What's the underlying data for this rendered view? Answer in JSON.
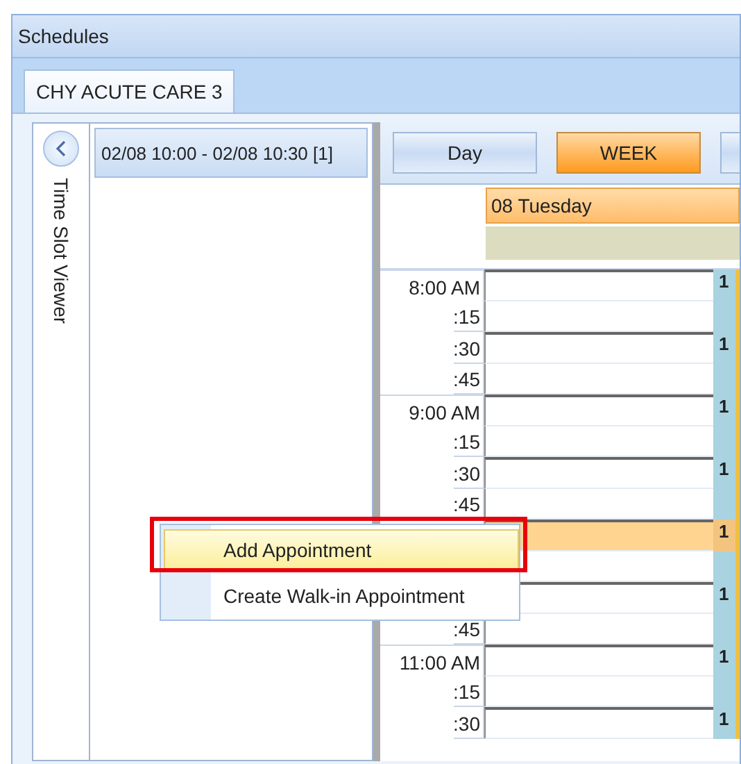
{
  "window": {
    "title": "Schedules"
  },
  "tabs": [
    {
      "label": "CHY ACUTE CARE 3",
      "selected": true
    }
  ],
  "side_panel": {
    "title": "Time Slot Viewer",
    "items": [
      {
        "label": "02/08 10:00 - 02/08 10:30 [1]",
        "selected": true
      }
    ]
  },
  "view_buttons": [
    {
      "label": "Day",
      "selected": false
    },
    {
      "label": "WEEK",
      "selected": true
    },
    {
      "selected": false
    }
  ],
  "day_header": {
    "label": "08 Tuesday"
  },
  "slots": [
    {
      "label": "8:00 AM",
      "hour": true,
      "count": "1",
      "selected": false
    },
    {
      "label": ":15",
      "hour": false,
      "selected": false
    },
    {
      "label": ":30",
      "hour": false,
      "count": "1",
      "selected": false
    },
    {
      "label": ":45",
      "hour": false,
      "selected": false
    },
    {
      "label": "9:00 AM",
      "hour": true,
      "count": "1",
      "selected": false
    },
    {
      "label": ":15",
      "hour": false,
      "selected": false
    },
    {
      "label": ":30",
      "hour": false,
      "count": "1",
      "selected": false
    },
    {
      "label": ":45",
      "hour": false,
      "selected": false
    },
    {
      "hour": true,
      "count": "1",
      "selected": true
    },
    {
      "selected": false
    },
    {
      "count": "1",
      "selected": false
    },
    {
      "label": ":45",
      "hour": false,
      "selected": false
    },
    {
      "label": "11:00 AM",
      "hour": true,
      "count": "1",
      "selected": false
    },
    {
      "label": ":15",
      "hour": false,
      "selected": false
    },
    {
      "label": ":30",
      "hour": false,
      "count": "1",
      "selected": false
    }
  ],
  "context_menu": {
    "items": [
      {
        "label": "Add Appointment",
        "selected": true
      },
      {
        "label": "Create Walk-in Appointment",
        "selected": false
      }
    ]
  }
}
